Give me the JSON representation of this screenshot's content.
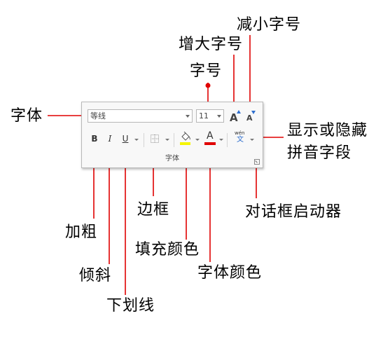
{
  "annotations": {
    "font_name": "字体",
    "font_size": "字号",
    "grow_font": "增大字号",
    "shrink_font": "减小字号",
    "phonetic_guide": "显示或隐藏\n拼音字段",
    "bold": "加粗",
    "italic": "倾斜",
    "underline": "下划线",
    "borders": "边框",
    "highlight": "填充颜色",
    "font_color": "字体颜色",
    "dialog_launcher": "对话框启动器"
  },
  "ribbon": {
    "font_name_value": "等线",
    "font_size_value": "11",
    "bold_label": "B",
    "italic_label": "I",
    "underline_label": "U",
    "font_color_label": "A",
    "grow_label": "A",
    "shrink_label": "A",
    "phonetic_top": "wén",
    "phonetic_bottom": "文",
    "group_label": "字体"
  },
  "colors": {
    "leader": "#e00000",
    "highlight_swatch": "#f5f500",
    "font_color_swatch": "#e00000",
    "grow_arrow": "#2f6fce",
    "shrink_arrow": "#2f6fce"
  }
}
